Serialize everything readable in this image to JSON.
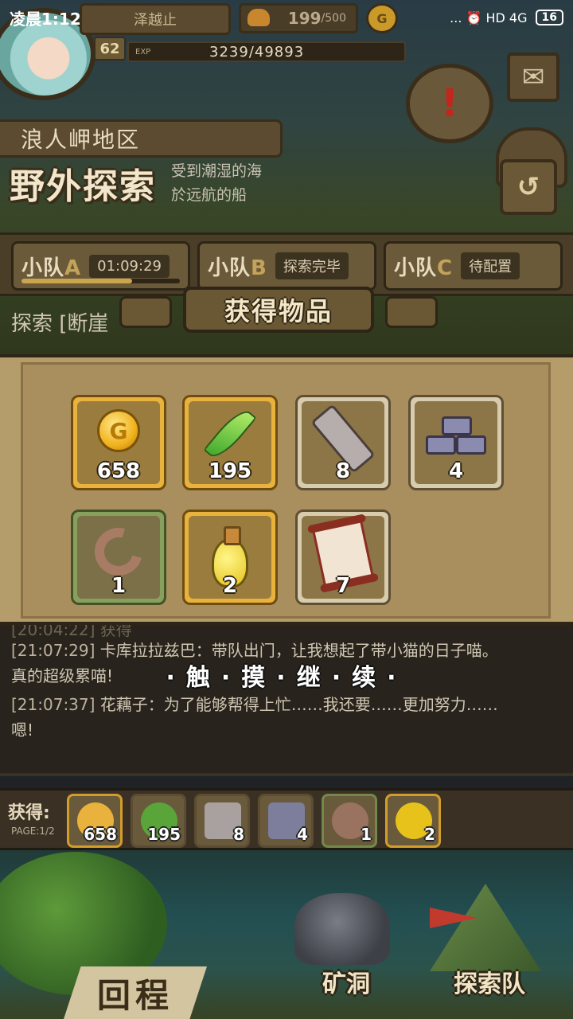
{
  "status_bar": {
    "time": "凌晨1:12",
    "icons": "... ⏰ HD 4G",
    "battery": "16"
  },
  "header": {
    "player_name": "泽越止",
    "food_current": "199",
    "food_max": "/500",
    "gold_icon": "G",
    "level": "62",
    "exp_tag": "EXP",
    "exp_value": "3239/49893"
  },
  "side_icons": {
    "quest": "!",
    "mail": "✉",
    "back": "↺"
  },
  "region": {
    "name": "浪人岬地区",
    "title": "野外探索",
    "desc_line1": "受到潮湿的海",
    "desc_line2": "於远航的船"
  },
  "teams": [
    {
      "letter": "A",
      "prefix": "小队",
      "status": "01:09:29",
      "progress": 0.7
    },
    {
      "letter": "B",
      "prefix": "小队",
      "status": "探索完毕",
      "progress": 0
    },
    {
      "letter": "C",
      "prefix": "小队",
      "status": "待配置",
      "progress": 0
    }
  ],
  "explore_line": "探索 [断崖",
  "reward_popup": {
    "title": "获得物品",
    "items": [
      {
        "icon": "gold-coin-icon",
        "count": "658",
        "rarity": "gold"
      },
      {
        "icon": "green-feather-icon",
        "count": "195",
        "rarity": "gold"
      },
      {
        "icon": "stone-slab-icon",
        "count": "8",
        "rarity": "plain"
      },
      {
        "icon": "stone-bricks-icon",
        "count": "4",
        "rarity": "plain"
      },
      {
        "icon": "horn-icon",
        "count": "1",
        "rarity": "green"
      },
      {
        "icon": "yellow-potion-icon",
        "count": "2",
        "rarity": "gold"
      },
      {
        "icon": "red-scroll-icon",
        "count": "7",
        "rarity": "plain"
      }
    ]
  },
  "log": {
    "line0": "[20:04:22] 获得",
    "line1_time": "[21:07:29]",
    "line1_text": " 卡库拉拉兹巴：带队出门，让我想起了带小猫的日子喵。",
    "line2_text": "真的超级累喵!",
    "line3_time": "[21:07:37]",
    "line3_text": " 花藕子：为了能够帮得上忙……我还要……更加努力……",
    "line4_text": "嗯!"
  },
  "touch_continue": "·触·摸·继·续·",
  "obtained": {
    "label": "获得:",
    "page": "PAGE:1/2",
    "items": [
      {
        "icon": "gold-coin-icon",
        "count": "658"
      },
      {
        "icon": "green-feather-icon",
        "count": "195"
      },
      {
        "icon": "stone-slab-icon",
        "count": "8"
      },
      {
        "icon": "stone-bricks-icon",
        "count": "4"
      },
      {
        "icon": "horn-icon",
        "count": "1"
      },
      {
        "icon": "yellow-potion-icon",
        "count": "2"
      }
    ]
  },
  "bottom_nav": {
    "return": "回程",
    "mine": "矿洞",
    "team": "探索队"
  }
}
